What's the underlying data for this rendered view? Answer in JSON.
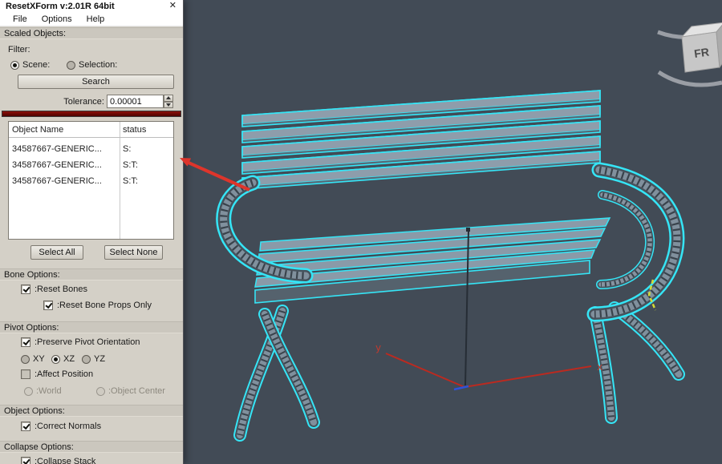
{
  "window": {
    "title": "ResetXForm v:2.01R 64bit",
    "close_glyph": "✕",
    "menu": [
      "File",
      "Options",
      "Help"
    ]
  },
  "scaled_objects": {
    "header": "Scaled Objects:",
    "filter_label": "Filter:",
    "scene_label": "Scene:",
    "scene_selected": true,
    "selection_label": "Selection:",
    "selection_selected": false,
    "search_label": "Search",
    "tolerance_label": "Tolerance:",
    "tolerance_value": "0.00001",
    "table": {
      "columns": [
        "Object Name",
        "status"
      ],
      "rows": [
        {
          "name": "34587667-GENERIC...",
          "status": "S:"
        },
        {
          "name": "34587667-GENERIC...",
          "status": "S:T:"
        },
        {
          "name": "34587667-GENERIC...",
          "status": "S:T:"
        }
      ]
    },
    "select_all_label": "Select All",
    "select_none_label": "Select None"
  },
  "bone_options": {
    "header": "Bone Options:",
    "reset_bones_label": ":Reset Bones",
    "reset_bones_checked": true,
    "reset_bone_props_label": ":Reset Bone Props Only",
    "reset_bone_props_checked": true
  },
  "pivot_options": {
    "header": "Pivot Options:",
    "preserve_label": ":Preserve Pivot Orientation",
    "preserve_checked": true,
    "xy_label": "XY",
    "xy_selected": false,
    "xz_label": "XZ",
    "xz_selected": true,
    "yz_label": "YZ",
    "yz_selected": false,
    "affect_label": ":Affect Position",
    "affect_checked": false,
    "world_label": ":World",
    "world_selected": false,
    "object_center_label": ":Object Center",
    "object_center_selected": false
  },
  "object_options": {
    "header": "Object Options:",
    "correct_normals_label": ":Correct Normals",
    "correct_normals_checked": true
  },
  "collapse_options": {
    "header": "Collapse Options:",
    "collapse_stack_label": ":Collapse Stack",
    "collapse_stack_checked": true
  },
  "viewport": {
    "axis_x_label": "x",
    "axis_y_label": "y",
    "viewcube_label": "FR"
  },
  "colors": {
    "viewport_background": "#424b56",
    "selection_outline": "#35e5f6",
    "annotation_arrow": "#de352b",
    "progress_bar": "#4e0301",
    "axis_red": "#bb2a20"
  }
}
